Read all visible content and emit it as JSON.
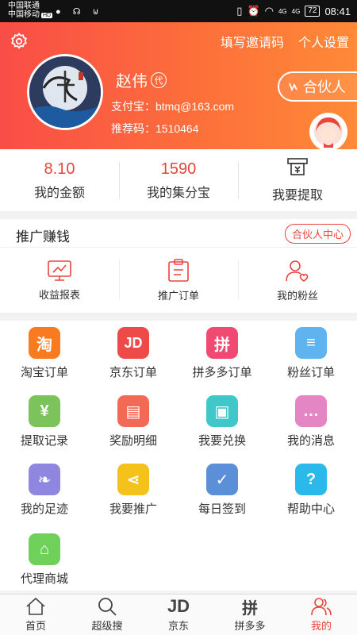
{
  "status_bar": {
    "carrier_1": "中国联通",
    "carrier_2": "中国移动",
    "hd": "HD",
    "signal_1": "4G",
    "signal_2": "4G",
    "battery": "72",
    "time": "08:41"
  },
  "header": {
    "invite_code_link": "填写邀请码",
    "settings_link": "个人设置",
    "username": "赵伟",
    "agent_badge": "代",
    "alipay_label": "支付宝：",
    "alipay_value": "btmq@163.com",
    "referral_label": "推荐码：",
    "referral_value": "1510464",
    "partner_button": "合伙人"
  },
  "stats": [
    {
      "value": "8.10",
      "label": "我的金额"
    },
    {
      "value": "1590",
      "label": "我的集分宝"
    },
    {
      "label": "我要提取",
      "icon": "withdraw-icon"
    }
  ],
  "promo": {
    "title": "推广赚钱",
    "partner_center": "合伙人中心",
    "items": [
      {
        "label": "收益报表",
        "icon": "report-icon"
      },
      {
        "label": "推广订单",
        "icon": "clipboard-icon"
      },
      {
        "label": "我的粉丝",
        "icon": "fans-icon"
      }
    ]
  },
  "grid": [
    {
      "label": "淘宝订单",
      "glyph": "淘",
      "color": "#f97a1f",
      "icon": "taobao-icon"
    },
    {
      "label": "京东订单",
      "glyph": "JD",
      "color": "#ef4a4a",
      "icon": "jd-icon"
    },
    {
      "label": "拼多多订单",
      "glyph": "拼",
      "color": "#f04a72",
      "icon": "pinduoduo-icon"
    },
    {
      "label": "粉丝订单",
      "glyph": "≡",
      "color": "#5fb3ee",
      "icon": "fans-order-icon"
    },
    {
      "label": "提取记录",
      "glyph": "¥",
      "color": "#7dc35b",
      "icon": "withdraw-record-icon"
    },
    {
      "label": "奖励明细",
      "glyph": "▤",
      "color": "#f26a55",
      "icon": "reward-detail-icon"
    },
    {
      "label": "我要兑换",
      "glyph": "▣",
      "color": "#3fc7c9",
      "icon": "gift-icon"
    },
    {
      "label": "我的消息",
      "glyph": "…",
      "color": "#e486c4",
      "icon": "message-icon"
    },
    {
      "label": "我的足迹",
      "glyph": "❧",
      "color": "#8f86e0",
      "icon": "footprint-icon"
    },
    {
      "label": "我要推广",
      "glyph": "⋖",
      "color": "#f5c21b",
      "icon": "share-icon"
    },
    {
      "label": "每日签到",
      "glyph": "✓",
      "color": "#5b8fd8",
      "icon": "calendar-icon"
    },
    {
      "label": "帮助中心",
      "glyph": "?",
      "color": "#2bb8ea",
      "icon": "help-icon"
    },
    {
      "label": "代理商城",
      "glyph": "⌂",
      "color": "#6fd05a",
      "icon": "store-icon"
    }
  ],
  "nav": [
    {
      "label": "首页",
      "icon": "home-icon"
    },
    {
      "label": "超级搜",
      "icon": "search-icon"
    },
    {
      "label": "京东",
      "icon": "jd-nav-icon",
      "glyph": "JD"
    },
    {
      "label": "拼多多",
      "icon": "pinduoduo-nav-icon",
      "glyph": "拼"
    },
    {
      "label": "我的",
      "icon": "user-icon"
    }
  ],
  "colors": {
    "accent": "#e8453c",
    "header_start": "#f94d47",
    "header_end": "#ff8a38"
  }
}
